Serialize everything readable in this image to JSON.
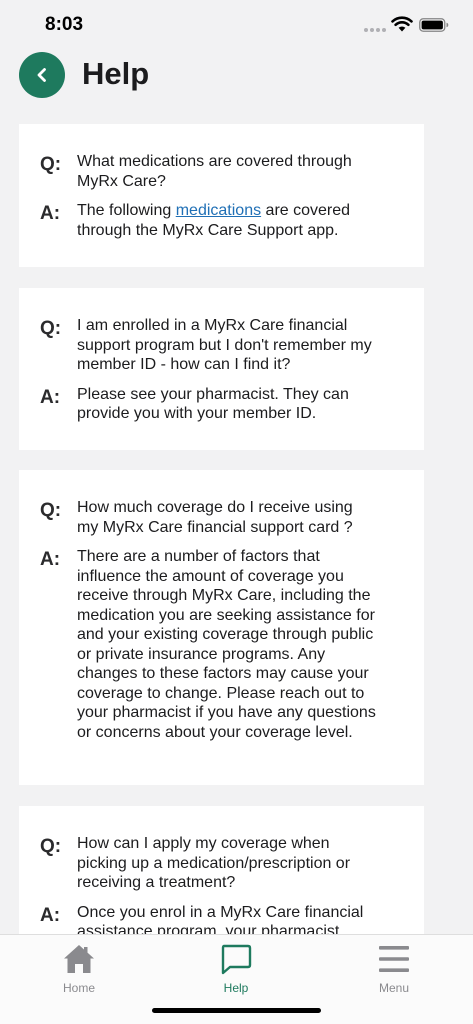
{
  "status_bar": {
    "time": "8:03"
  },
  "header": {
    "title": "Help"
  },
  "faq": {
    "q_tag": "Q:",
    "a_tag": "A:",
    "items": [
      {
        "question": "What medications are covered through MyRx Care?",
        "answer_before_link": "The following ",
        "answer_link": "medications",
        "answer_after_link": " are covered through the MyRx Care Support app."
      },
      {
        "question": "I am enrolled in a MyRx Care financial support program but I don't remember my member ID - how can I find it?",
        "answer": "Please see your pharmacist. They can provide you with your member ID."
      },
      {
        "question": "How much coverage do I receive using my MyRx Care financial support card ?",
        "answer": "There are a number of factors that influence the amount of coverage you receive through MyRx Care, including the medication you are seeking assistance for and your existing coverage through public or private insurance programs. Any changes to these factors may cause your coverage to change. Please reach out to your pharmacist if you have any questions or concerns about your coverage level."
      },
      {
        "question": "How can I apply my coverage when picking up a medication/prescription or receiving a treatment?",
        "answer": "Once you enrol in a MyRx Care financial assistance program, your pharmacist"
      }
    ]
  },
  "tab_bar": {
    "tabs": [
      {
        "label": "Home",
        "icon": "home-icon"
      },
      {
        "label": "Help",
        "icon": "chat-bubble-icon",
        "active": true
      },
      {
        "label": "Menu",
        "icon": "hamburger-menu-icon"
      }
    ]
  },
  "colors": {
    "accent": "#1e7a5e",
    "link": "#1f6fb5",
    "background": "#f2f2f3",
    "card": "#ffffff",
    "inactive_tab": "#8a8a8e"
  }
}
